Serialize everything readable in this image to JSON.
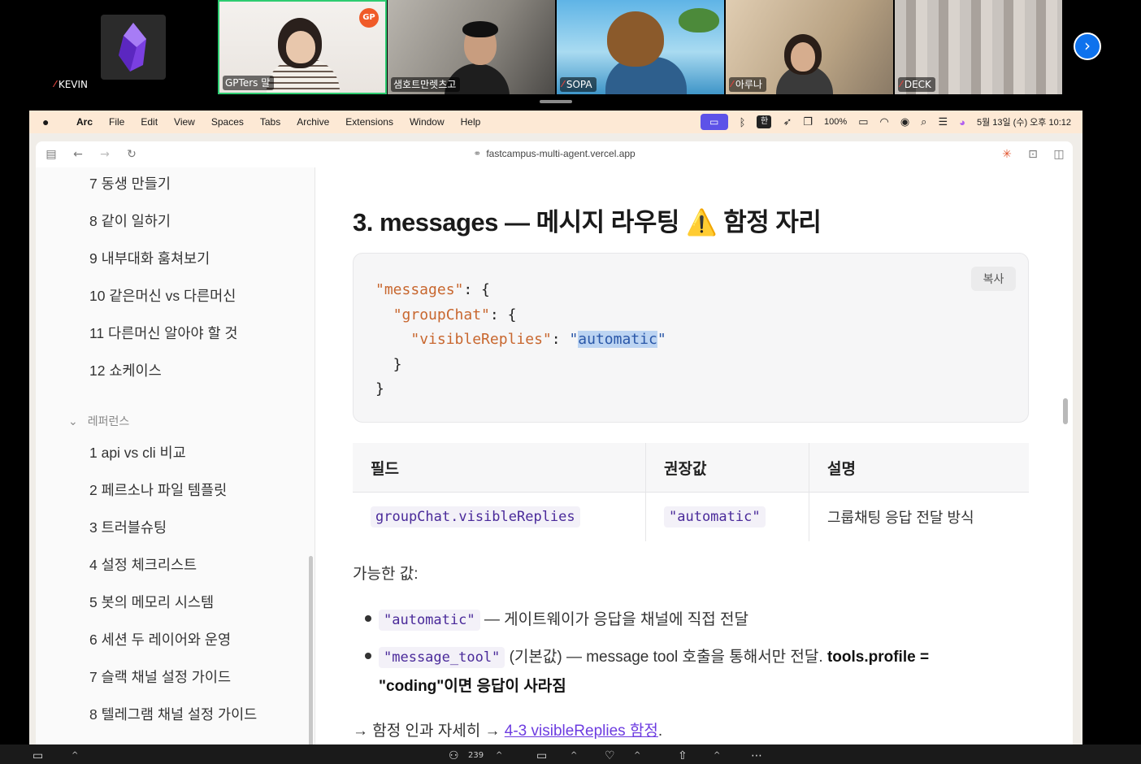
{
  "participants": [
    {
      "name": "KEVIN"
    },
    {
      "name": "GPTers 말"
    },
    {
      "name": "샘호트만렛츠고"
    },
    {
      "name": "SOPA"
    },
    {
      "name": "아루나"
    },
    {
      "name": "DECK"
    }
  ],
  "gpters_badge": "GP",
  "mac_menu": {
    "app": "Arc",
    "items": [
      "File",
      "Edit",
      "View",
      "Spaces",
      "Tabs",
      "Archive",
      "Extensions",
      "Window",
      "Help"
    ],
    "input_source": "한",
    "battery": "100%",
    "datetime": "5월 13일 (수) 오후 10:12"
  },
  "browser": {
    "url": "fastcampus-multi-agent.vercel.app"
  },
  "sidebar": {
    "items_top": [
      "7 동생 만들기",
      "8 같이 일하기",
      "9 내부대화 훔쳐보기",
      "10 같은머신 vs 다른머신",
      "11 다른머신 알아야 할 것",
      "12 쇼케이스"
    ],
    "section_label": "레퍼런스",
    "items_ref": [
      "1 api vs cli 비교",
      "2 페르소나 파일 템플릿",
      "3 트러블슈팅",
      "4 설정 체크리스트",
      "5 봇의 메모리 시스템",
      "6 세션 두 레이어와 운영",
      "7 슬랙 채널 설정 가이드",
      "8 텔레그램 채널 설정 가이드"
    ]
  },
  "content": {
    "heading_prefix": "3. messages — 메시지 라우팅",
    "heading_warn": "⚠️",
    "heading_suffix": "함정 자리",
    "copy_label": "복사",
    "code": {
      "k_messages": "\"messages\"",
      "k_group": "\"groupChat\"",
      "k_visible": "\"visibleReplies\"",
      "v_auto": "automatic"
    },
    "table": {
      "headers": [
        "필드",
        "권장값",
        "설명"
      ],
      "row": [
        "groupChat.visibleReplies",
        "\"automatic\"",
        "그룹채팅 응답 전달 방식"
      ]
    },
    "possible_values_label": "가능한 값:",
    "bullet1_code": "\"automatic\"",
    "bullet1_text": " — 게이트웨이가 응답을 채널에 직접 전달",
    "bullet2_code": "\"message_tool\"",
    "bullet2_text": " (기본값) — message tool 호출을 통해서만 전달. ",
    "bullet2_bold": "tools.profile =",
    "bullet2_line2_bold": "\"coding\"이면 응답이 사라짐",
    "trap_prefix": "→ 함정 인과 자세히 → ",
    "trap_link": "4-3 visibleReplies 함정",
    "trap_suffix": "."
  },
  "zoom_toolbar": {
    "participants_count": "239"
  }
}
